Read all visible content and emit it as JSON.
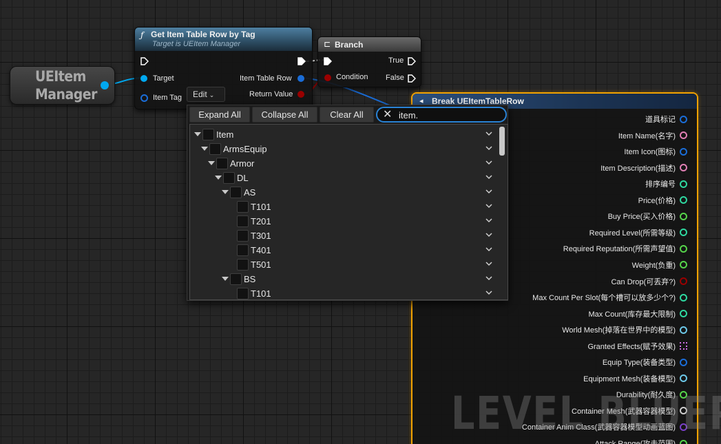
{
  "variable_node": {
    "title": "UEItem Manager"
  },
  "get_node": {
    "title": "Get Item Table Row by Tag",
    "subtitle": "Target is UEItem Manager",
    "target_label": "Target",
    "item_tag_label": "Item Tag",
    "edit_label": "Edit",
    "row_label": "Item Table Row",
    "return_label": "Return Value"
  },
  "branch_node": {
    "title": "Branch",
    "condition_label": "Condition",
    "true_label": "True",
    "false_label": "False"
  },
  "break_node": {
    "title": "Break UEItemTableRow",
    "pins": [
      {
        "label": "道具标记",
        "color": "#1a6dd8",
        "shape": "circle"
      },
      {
        "label": "Item Name(名字)",
        "color": "#e07fb4",
        "shape": "circle"
      },
      {
        "label": "Item Icon(图标)",
        "color": "#1a6dd8",
        "shape": "circle"
      },
      {
        "label": "Item Description(描述)",
        "color": "#e07fb4",
        "shape": "circle"
      },
      {
        "label": "排序编号",
        "color": "#2ed8a0",
        "shape": "circle"
      },
      {
        "label": "Price(价格)",
        "color": "#2ed8a0",
        "shape": "circle"
      },
      {
        "label": "Buy Price(买入价格)",
        "color": "#55d44a",
        "shape": "circle"
      },
      {
        "label": "Required Level(所需等级)",
        "color": "#2ed8a0",
        "shape": "circle"
      },
      {
        "label": "Required Reputation(所需声望值)",
        "color": "#55d44a",
        "shape": "circle"
      },
      {
        "label": "Weight(负重)",
        "color": "#55d44a",
        "shape": "circle"
      },
      {
        "label": "Can Drop(可丢弃?)",
        "color": "#9a0000",
        "shape": "circle"
      },
      {
        "label": "Max Count Per Slot(每个槽可以放多少个?)",
        "color": "#2ed8a0",
        "shape": "circle"
      },
      {
        "label": "Max Count(库存最大限制)",
        "color": "#2ed8a0",
        "shape": "circle"
      },
      {
        "label": "World Mesh(掉落在世界中的模型)",
        "color": "#6cc8e8",
        "shape": "circle"
      },
      {
        "label": "Granted Effects(赋予效果)",
        "color": "#d070e8",
        "shape": "square"
      },
      {
        "label": "Equip Type(装备类型)",
        "color": "#1a6dd8",
        "shape": "circle"
      },
      {
        "label": "Equipment Mesh(装备模型)",
        "color": "#6cc8e8",
        "shape": "circle"
      },
      {
        "label": "Durability(耐久度)",
        "color": "#55d44a",
        "shape": "circle"
      },
      {
        "label": "Container Mesh(武器容器模型)",
        "color": "#cfcfcf",
        "shape": "circle"
      },
      {
        "label": "Container Anim Class(武器容器模型动画蓝图)",
        "color": "#7a3fc8",
        "shape": "circle"
      },
      {
        "label": "Attack Range(攻击范围)",
        "color": "#55d44a",
        "shape": "circle"
      }
    ]
  },
  "watermark": "LEVEL BLUEPRINT",
  "tag_picker": {
    "expand_all": "Expand All",
    "collapse_all": "Collapse All",
    "clear_all": "Clear All",
    "search_value": "item.",
    "tree": [
      {
        "label": "Item",
        "depth": 0,
        "expanded": true
      },
      {
        "label": "ArmsEquip",
        "depth": 1,
        "expanded": true
      },
      {
        "label": "Armor",
        "depth": 2,
        "expanded": true
      },
      {
        "label": "DL",
        "depth": 3,
        "expanded": true
      },
      {
        "label": "AS",
        "depth": 4,
        "expanded": true
      },
      {
        "label": "T101",
        "depth": 5,
        "expanded": false
      },
      {
        "label": "T201",
        "depth": 5,
        "expanded": false
      },
      {
        "label": "T301",
        "depth": 5,
        "expanded": false
      },
      {
        "label": "T401",
        "depth": 5,
        "expanded": false
      },
      {
        "label": "T501",
        "depth": 5,
        "expanded": false
      },
      {
        "label": "BS",
        "depth": 4,
        "expanded": true
      },
      {
        "label": "T101",
        "depth": 5,
        "expanded": false
      }
    ]
  }
}
